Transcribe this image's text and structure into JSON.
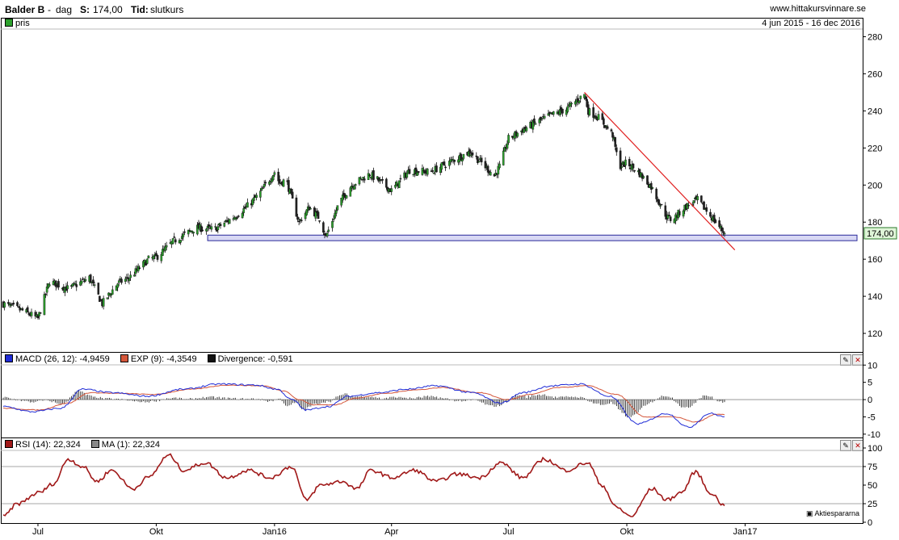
{
  "header": {
    "ticker": "Balder B",
    "sep": "-",
    "interval": "dag",
    "price_label": "S:",
    "price_value": "174,00",
    "time_label": "Tid:",
    "time_value": "slutkurs",
    "site": "www.hittakursvinnare.se",
    "range": "4 jun 2015 - 16 dec 2016"
  },
  "colors": {
    "up": "#2ca02c",
    "down": "#222222",
    "trendline": "#e02020",
    "support_fill": "#d8d8f4",
    "support_stroke": "#2a2a9a",
    "macd": "#1f2bd6",
    "exp": "#d4563a",
    "rsi": "#a01818",
    "grid": "#8a8a8a"
  },
  "price_panel": {
    "legend": "pris",
    "last_price_tag": "174,00",
    "yticks": [
      "120",
      "140",
      "160",
      "180",
      "200",
      "220",
      "240",
      "260",
      "280"
    ]
  },
  "macd_panel": {
    "macd_label": "MACD (26, 12): -4,9459",
    "exp_label": "EXP (9): -4,3549",
    "div_label": "Divergence: -0,591",
    "yticks": [
      "-10",
      "-5",
      "0",
      "5",
      "10"
    ]
  },
  "rsi_panel": {
    "rsi_label": "RSI (14): 22,324",
    "ma_label": "MA (1): 22,324",
    "yticks": [
      "0",
      "25",
      "50",
      "75",
      "100"
    ],
    "watermark": "Aktiespararna"
  },
  "xaxis": {
    "labels": [
      "Jul",
      "Okt",
      "Jan16",
      "Apr",
      "Jul",
      "Okt",
      "Jan17"
    ]
  },
  "chart_data": [
    {
      "type": "candlestick",
      "title": "Balder B - dag",
      "x_range": [
        "4 jun 2015",
        "16 dec 2016"
      ],
      "ylim": [
        110,
        285
      ],
      "anchors": {
        "dates": [
          "2015-06-04",
          "2015-06-20",
          "2015-07-01",
          "2015-07-10",
          "2015-07-25",
          "2015-08-10",
          "2015-08-20",
          "2015-09-01",
          "2015-09-10",
          "2015-09-25",
          "2015-10-01",
          "2015-10-15",
          "2015-11-01",
          "2015-11-15",
          "2015-12-01",
          "2015-12-10",
          "2015-12-20",
          "2016-01-01",
          "2016-01-05",
          "2016-01-10",
          "2016-01-20",
          "2016-01-28",
          "2016-02-05",
          "2016-02-10",
          "2016-02-20",
          "2016-03-01",
          "2016-03-15",
          "2016-04-01",
          "2016-04-15",
          "2016-05-01",
          "2016-05-15",
          "2016-06-01",
          "2016-06-10",
          "2016-06-20",
          "2016-06-24",
          "2016-07-01",
          "2016-07-15",
          "2016-08-01",
          "2016-08-15",
          "2016-08-29",
          "2016-09-01",
          "2016-09-10",
          "2016-09-20",
          "2016-09-25",
          "2016-10-01",
          "2016-10-10",
          "2016-10-20",
          "2016-11-01",
          "2016-11-05",
          "2016-11-15",
          "2016-11-25",
          "2016-12-01",
          "2016-12-16"
        ],
        "close": [
          136,
          132,
          128,
          148,
          144,
          150,
          136,
          147,
          150,
          160,
          161,
          170,
          177,
          176,
          183,
          188,
          195,
          207,
          201,
          203,
          180,
          188,
          182,
          172,
          190,
          200,
          206,
          197,
          208,
          207,
          212,
          218,
          212,
          205,
          210,
          225,
          231,
          237,
          241,
          249,
          240,
          236,
          227,
          210,
          212,
          207,
          199,
          183,
          181,
          188,
          192,
          187,
          174
        ]
      },
      "support_zone": [
        170,
        173
      ],
      "trendline": {
        "from": {
          "date": "2016-08-29",
          "value": 250
        },
        "to": {
          "date": "2016-12-24",
          "value": 165
        }
      },
      "last": 174.0
    },
    {
      "type": "line",
      "title": "MACD (26, 12)",
      "ylim": [
        -10.5,
        11
      ],
      "series": [
        {
          "name": "MACD (26, 12)",
          "value": -4.9459,
          "anchors": [
            [
              0,
              -2
            ],
            [
              0.04,
              -3.5
            ],
            [
              0.08,
              -2.5
            ],
            [
              0.11,
              3
            ],
            [
              0.15,
              2
            ],
            [
              0.2,
              1
            ],
            [
              0.25,
              3
            ],
            [
              0.3,
              4.5
            ],
            [
              0.35,
              4.2
            ],
            [
              0.38,
              3
            ],
            [
              0.4,
              0
            ],
            [
              0.42,
              -3
            ],
            [
              0.45,
              -2
            ],
            [
              0.48,
              1
            ],
            [
              0.52,
              2
            ],
            [
              0.56,
              3
            ],
            [
              0.6,
              4
            ],
            [
              0.65,
              2
            ],
            [
              0.69,
              -1
            ],
            [
              0.72,
              2
            ],
            [
              0.76,
              4
            ],
            [
              0.8,
              4.5
            ],
            [
              0.84,
              1
            ],
            [
              0.88,
              -7
            ],
            [
              0.92,
              -4
            ],
            [
              0.95,
              -8
            ],
            [
              0.98,
              -4
            ],
            [
              1,
              -4.95
            ]
          ]
        },
        {
          "name": "EXP (9)",
          "value": -4.3549,
          "anchors": [
            [
              0,
              -2.5
            ],
            [
              0.05,
              -3
            ],
            [
              0.09,
              -1
            ],
            [
              0.12,
              2
            ],
            [
              0.16,
              1.8
            ],
            [
              0.21,
              1.5
            ],
            [
              0.26,
              3
            ],
            [
              0.31,
              4.2
            ],
            [
              0.36,
              4
            ],
            [
              0.39,
              2.5
            ],
            [
              0.41,
              0
            ],
            [
              0.43,
              -1.5
            ],
            [
              0.46,
              -1.5
            ],
            [
              0.49,
              0.5
            ],
            [
              0.53,
              1.8
            ],
            [
              0.57,
              2.8
            ],
            [
              0.61,
              3.5
            ],
            [
              0.66,
              2
            ],
            [
              0.7,
              0
            ],
            [
              0.73,
              1.5
            ],
            [
              0.77,
              3.5
            ],
            [
              0.81,
              4
            ],
            [
              0.85,
              1.5
            ],
            [
              0.89,
              -5
            ],
            [
              0.93,
              -5
            ],
            [
              0.96,
              -6.5
            ],
            [
              0.99,
              -4.2
            ],
            [
              1,
              -4.35
            ]
          ]
        },
        {
          "name": "Divergence",
          "value": -0.591
        }
      ]
    },
    {
      "type": "line",
      "title": "RSI (14)",
      "ylim": [
        0,
        100
      ],
      "series": [
        {
          "name": "RSI (14)",
          "value": 22.324,
          "anchors": [
            [
              0,
              8
            ],
            [
              0.02,
              25
            ],
            [
              0.05,
              40
            ],
            [
              0.07,
              52
            ],
            [
              0.09,
              85
            ],
            [
              0.11,
              75
            ],
            [
              0.13,
              55
            ],
            [
              0.15,
              70
            ],
            [
              0.18,
              45
            ],
            [
              0.2,
              60
            ],
            [
              0.23,
              90
            ],
            [
              0.25,
              70
            ],
            [
              0.28,
              80
            ],
            [
              0.31,
              60
            ],
            [
              0.34,
              70
            ],
            [
              0.37,
              60
            ],
            [
              0.4,
              75
            ],
            [
              0.42,
              30
            ],
            [
              0.44,
              50
            ],
            [
              0.47,
              55
            ],
            [
              0.49,
              45
            ],
            [
              0.51,
              70
            ],
            [
              0.54,
              60
            ],
            [
              0.57,
              70
            ],
            [
              0.6,
              55
            ],
            [
              0.63,
              65
            ],
            [
              0.66,
              60
            ],
            [
              0.69,
              80
            ],
            [
              0.72,
              60
            ],
            [
              0.75,
              85
            ],
            [
              0.78,
              70
            ],
            [
              0.81,
              80
            ],
            [
              0.83,
              50
            ],
            [
              0.85,
              20
            ],
            [
              0.87,
              8
            ],
            [
              0.9,
              45
            ],
            [
              0.92,
              30
            ],
            [
              0.94,
              40
            ],
            [
              0.96,
              68
            ],
            [
              0.98,
              40
            ],
            [
              1,
              22.3
            ]
          ]
        },
        {
          "name": "MA (1)",
          "value": 22.324
        }
      ]
    }
  ]
}
